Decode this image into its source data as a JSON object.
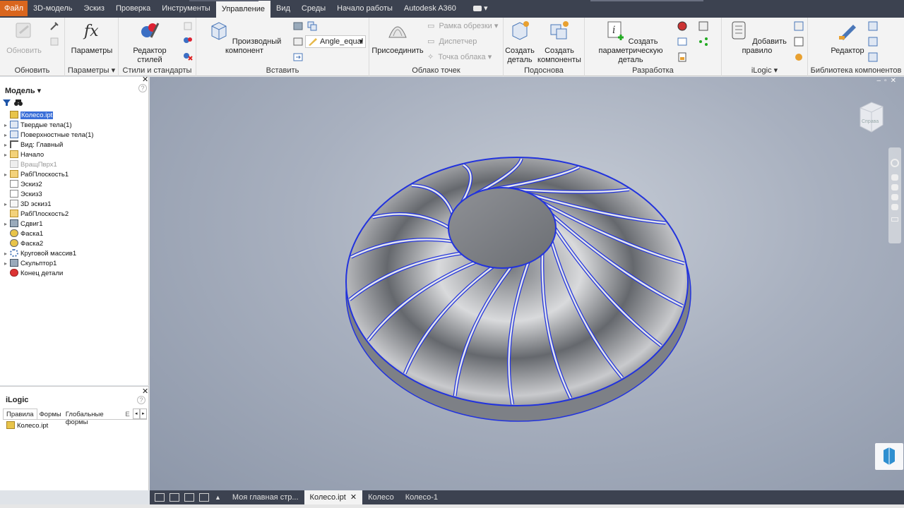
{
  "tabs": [
    "Файл",
    "3D-модель",
    "Эскиз",
    "Проверка",
    "Инструменты",
    "Управление",
    "Вид",
    "Среды",
    "Начало работы",
    "Autodesk A360"
  ],
  "active_tab": "Управление",
  "ribbon": {
    "update": {
      "button": "Обновить",
      "panel": "Обновить"
    },
    "params": {
      "button": "Параметры",
      "panel": "Параметры"
    },
    "styles": {
      "button": "Редактор стилей",
      "panel": "Стили и стандарты"
    },
    "insert": {
      "button": "Производный компонент",
      "dropdown": "Angle_equal",
      "panel": "Вставить"
    },
    "pointcloud": {
      "button": "Присоединить",
      "crop": "Рамка обрезки",
      "manager": "Диспетчер",
      "points": "Точка облака",
      "panel": "Облако точек"
    },
    "layout": {
      "part": "Создать деталь",
      "components": "Создать компоненты",
      "panel": "Подоснова"
    },
    "author": {
      "button": "Создать параметрическую деталь",
      "panel": "Разработка"
    },
    "ilogic": {
      "button": "Добавить правило",
      "panel": "iLogic"
    },
    "library": {
      "button": "Редактор",
      "panel": "Библиотека компонентов"
    }
  },
  "browser": {
    "title": "Модель",
    "items": [
      {
        "label": "Колесо.ipt",
        "selected": true
      },
      {
        "label": "Твердые тела(1)"
      },
      {
        "label": "Поверхностные тела(1)"
      },
      {
        "label": "Вид: Главный"
      },
      {
        "label": "Начало"
      },
      {
        "label": "ВращПврх1",
        "dim": true
      },
      {
        "label": "РабПлоскость1"
      },
      {
        "label": "Эскиз2"
      },
      {
        "label": "Эскиз3"
      },
      {
        "label": "3D эскиз1"
      },
      {
        "label": "РабПлоскость2"
      },
      {
        "label": "Сдвиг1"
      },
      {
        "label": "Фаска1"
      },
      {
        "label": "Фаска2"
      },
      {
        "label": "Круговой массив1"
      },
      {
        "label": "Скульптор1"
      },
      {
        "label": "Конец детали"
      }
    ]
  },
  "ilogic_panel": {
    "title": "iLogic",
    "tabs": [
      "Правила",
      "Формы",
      "Глобальные формы",
      "E"
    ],
    "item": "Колесо.ipt"
  },
  "viewcube": {
    "label": "Справа"
  },
  "doc_tabs": [
    "Моя главная стр...",
    "Колесо.ipt",
    "Колесо",
    "Колесо-1"
  ],
  "colors": {
    "file_tab": "#d9661e",
    "edge_highlight": "#2233dd",
    "titlebar": "#3c4250"
  }
}
